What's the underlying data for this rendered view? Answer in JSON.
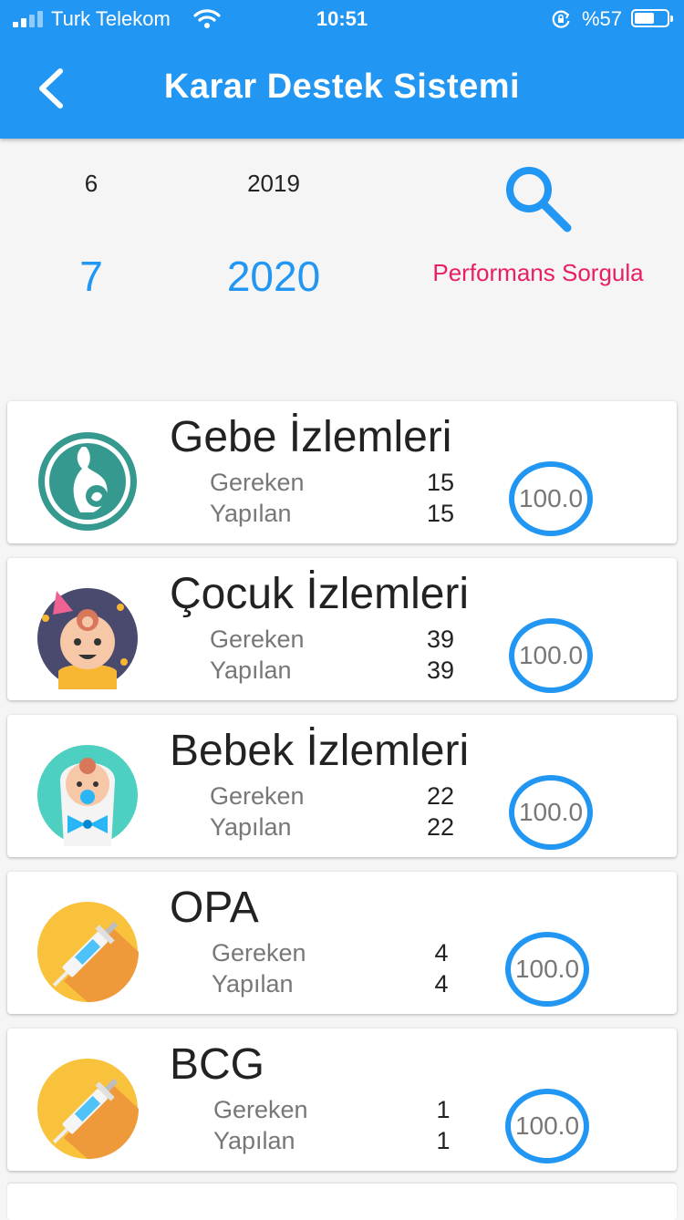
{
  "status_bar": {
    "carrier": "Turk Telekom",
    "time": "10:51",
    "battery": "%57"
  },
  "header": {
    "title": "Karar Destek Sistemi",
    "back_icon": "chevron-left-icon"
  },
  "picker": {
    "month_prev": "6",
    "year_prev": "2019",
    "month": "7",
    "year": "2020"
  },
  "search_icon": "magnifier-icon",
  "perf_button": "Performans Sorgula",
  "labels": {
    "required": "Gereken",
    "done": "Yapılan"
  },
  "cards": [
    {
      "name": "Gebe İzlemleri",
      "required": "15",
      "done": "15",
      "score": "100.0",
      "icon": "pregnancy-icon"
    },
    {
      "name": "Çocuk İzlemleri",
      "required": "39",
      "done": "39",
      "score": "100.0",
      "icon": "child-icon"
    },
    {
      "name": "Bebek İzlemleri",
      "required": "22",
      "done": "22",
      "score": "100.0",
      "icon": "baby-icon"
    },
    {
      "name": "OPA",
      "required": "4",
      "done": "4",
      "score": "100.0",
      "icon": "syringe-icon"
    },
    {
      "name": "BCG",
      "required": "1",
      "done": "1",
      "score": "100.0",
      "icon": "syringe-icon"
    }
  ],
  "colors": {
    "primary": "#2196f3",
    "accent": "#e91e63"
  }
}
